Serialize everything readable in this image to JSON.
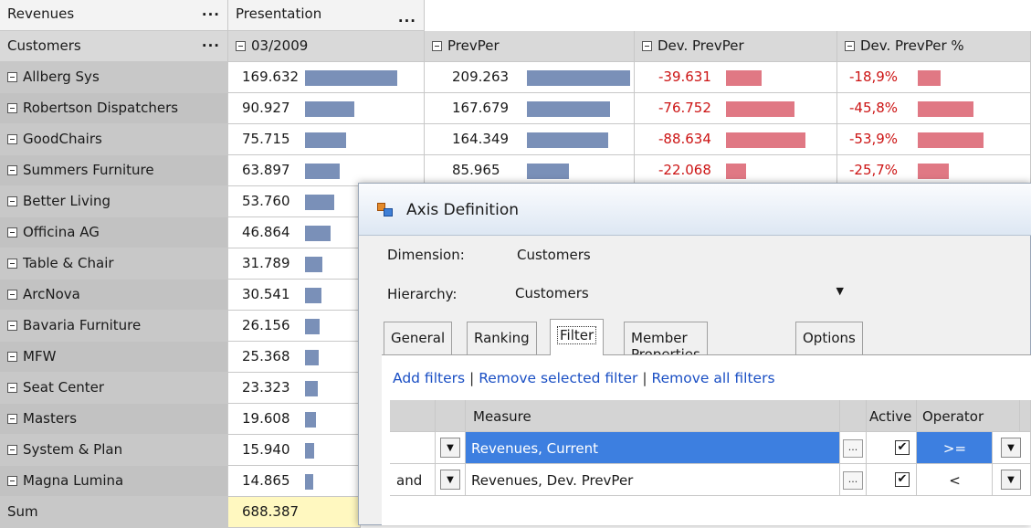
{
  "header_top": {
    "measure_label": "Revenues",
    "presentation_label": "Presentation",
    "dots": "..."
  },
  "header": {
    "row_dimension": "Customers",
    "dots": "...",
    "columns": [
      "03/2009",
      "PrevPer",
      "Dev. PrevPer",
      "Dev. PrevPer %"
    ]
  },
  "rows": [
    {
      "name": "Allberg Sys",
      "current": "169.632",
      "prev": "209.263",
      "dev": "-39.631",
      "devpct": "-18,9%"
    },
    {
      "name": "Robertson Dispatchers",
      "current": "90.927",
      "prev": "167.679",
      "dev": "-76.752",
      "devpct": "-45,8%"
    },
    {
      "name": "GoodChairs",
      "current": "75.715",
      "prev": "164.349",
      "dev": "-88.634",
      "devpct": "-53,9%"
    },
    {
      "name": "Summers Furniture",
      "current": "63.897",
      "prev": "85.965",
      "dev": "-22.068",
      "devpct": "-25,7%"
    },
    {
      "name": "Better Living",
      "current": "53.760"
    },
    {
      "name": "Officina AG",
      "current": "46.864"
    },
    {
      "name": "Table & Chair",
      "current": "31.789"
    },
    {
      "name": "ArcNova",
      "current": "30.541"
    },
    {
      "name": "Bavaria Furniture",
      "current": "26.156"
    },
    {
      "name": "MFW",
      "current": "25.368"
    },
    {
      "name": "Seat Center",
      "current": "23.323"
    },
    {
      "name": "Masters",
      "current": "19.608"
    },
    {
      "name": "System & Plan",
      "current": "15.940"
    },
    {
      "name": "Magna Lumina",
      "current": "14.865"
    }
  ],
  "sum": {
    "label": "Sum",
    "value": "688.387"
  },
  "bar_scale_max": 209263,
  "colors": {
    "bar_positive": "#7a90b8",
    "bar_negative": "#e07884",
    "negative_text": "#cc1414",
    "selection": "#3d7fe0",
    "link": "#1a4fc4"
  },
  "dialog": {
    "title": "Axis Definition",
    "icon": "axis-definition-icon",
    "dimension_label": "Dimension:",
    "dimension_value": "Customers",
    "hierarchy_label": "Hierarchy:",
    "hierarchy_value": "Customers",
    "tabs": [
      "General",
      "Ranking",
      "Filter",
      "Member Properties",
      "Options"
    ],
    "active_tab": "Filter",
    "links": {
      "add": "Add filters",
      "remove_selected": "Remove selected filter",
      "remove_all": "Remove all filters",
      "sep": "|"
    },
    "filter_headers": {
      "measure": "Measure",
      "active": "Active",
      "operator": "Operator"
    },
    "filters": [
      {
        "conj": "",
        "measure": "Revenues, Current",
        "active": true,
        "operator": ">=",
        "ellipsis": "...",
        "selected": true
      },
      {
        "conj": "and",
        "measure": "Revenues, Dev. PrevPer",
        "active": true,
        "operator": "<",
        "ellipsis": "...",
        "selected": false
      }
    ]
  }
}
